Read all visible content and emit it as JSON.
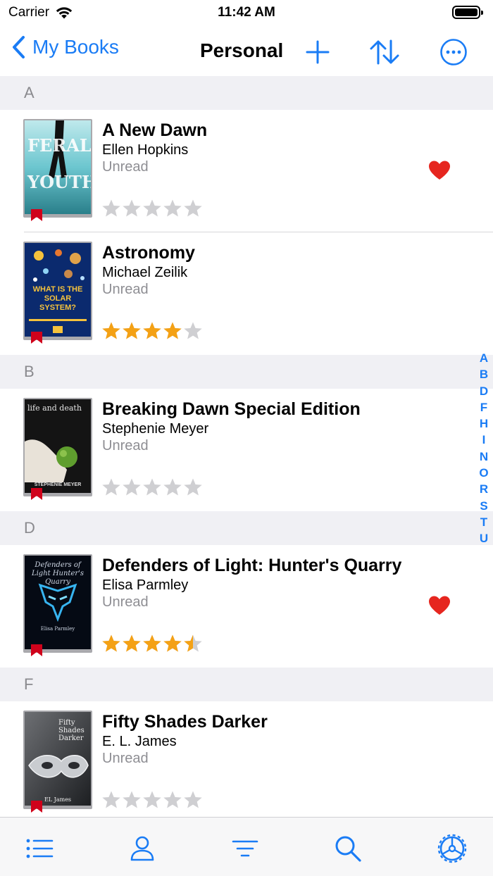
{
  "status_bar": {
    "carrier": "Carrier",
    "time": "11:42 AM"
  },
  "nav": {
    "back_label": "My Books",
    "title": "Personal"
  },
  "accent_color": "#1a7cf5",
  "sections": [
    {
      "letter": "A",
      "books": [
        {
          "title": "A New Dawn",
          "author": "Ellen Hopkins",
          "status": "Unread",
          "rating": 0,
          "favorite": true,
          "cover_title": "FERAL YOUTH"
        },
        {
          "title": "Astronomy",
          "author": "Michael Zeilik",
          "status": "Unread",
          "rating": 4,
          "favorite": false,
          "cover_title": "WHAT IS THE SOLAR SYSTEM?"
        }
      ]
    },
    {
      "letter": "B",
      "books": [
        {
          "title": "Breaking Dawn Special Edition",
          "author": "Stephenie Meyer",
          "status": "Unread",
          "rating": 0,
          "favorite": false,
          "cover_title": "life and death",
          "cover_author": "STEPHENIE MEYER"
        }
      ]
    },
    {
      "letter": "D",
      "books": [
        {
          "title": "Defenders of Light: Hunter's Quarry",
          "author": "Elisa Parmley",
          "status": "Unread",
          "rating": 4.5,
          "favorite": true,
          "cover_title": "Defenders of Light Hunter's Quarry",
          "cover_author": "Elisa Parmley"
        }
      ]
    },
    {
      "letter": "F",
      "books": [
        {
          "title": "Fifty Shades Darker",
          "author": "E. L. James",
          "status": "Unread",
          "rating": 0,
          "favorite": false,
          "cover_title": "Fifty Shades Darker",
          "cover_author": "EL James"
        }
      ]
    }
  ],
  "index_letters": [
    "A",
    "B",
    "D",
    "F",
    "H",
    "I",
    "N",
    "O",
    "R",
    "S",
    "T",
    "U"
  ],
  "tabs": [
    "list-icon",
    "profile-icon",
    "filter-icon",
    "search-icon",
    "settings-icon"
  ]
}
